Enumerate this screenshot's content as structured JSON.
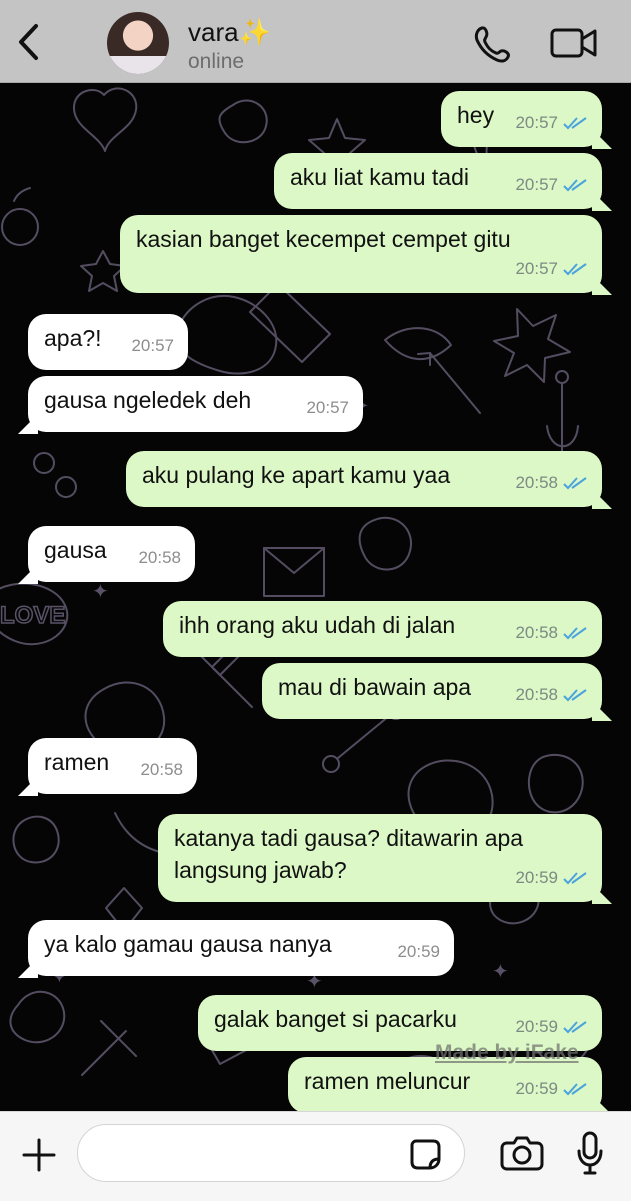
{
  "header": {
    "contact_name": "vara",
    "status": "online",
    "icons": {
      "back": "chevron-left-icon",
      "phone": "phone-icon",
      "video": "video-call-icon",
      "sparkles": "sparkles-icon"
    }
  },
  "messages": [
    {
      "direction": "out",
      "text": "hey",
      "time": "20:57"
    },
    {
      "direction": "out",
      "text": "aku liat kamu tadi",
      "time": "20:57"
    },
    {
      "direction": "out",
      "text": "kasian banget kecempet cempet gitu",
      "time": "20:57"
    },
    {
      "direction": "in",
      "text": "apa?!",
      "time": "20:57"
    },
    {
      "direction": "in",
      "text": "gausa ngeledek deh",
      "time": "20:57"
    },
    {
      "direction": "out",
      "text": "aku pulang ke apart kamu yaa",
      "time": "20:58"
    },
    {
      "direction": "in",
      "text": "gausa",
      "time": "20:58"
    },
    {
      "direction": "out",
      "text": "ihh orang aku udah di jalan",
      "time": "20:58"
    },
    {
      "direction": "out",
      "text": "mau di bawain apa",
      "time": "20:58"
    },
    {
      "direction": "in",
      "text": "ramen",
      "time": "20:58"
    },
    {
      "direction": "out",
      "text": "katanya tadi gausa? ditawarin apa\nlangsung jawab?",
      "time": "20:59"
    },
    {
      "direction": "in",
      "text": "ya kalo gamau gausa nanya",
      "time": "20:59"
    },
    {
      "direction": "out",
      "text": "galak banget si pacarku",
      "time": "20:59"
    },
    {
      "direction": "out",
      "text": "ramen meluncur",
      "time": "20:59"
    }
  ],
  "watermark": "Made by iFake",
  "composer": {
    "input_value": "",
    "placeholder": "",
    "icons": {
      "add": "plus-icon",
      "sticker": "sticker-icon",
      "camera": "camera-icon",
      "microphone": "microphone-icon"
    }
  },
  "colors": {
    "header_background": "#c4c4c4",
    "chat_background": "#050505",
    "outgoing_bubble": "#dcf8c6",
    "incoming_bubble": "#ffffff",
    "read_tick": "#4aa3df"
  }
}
